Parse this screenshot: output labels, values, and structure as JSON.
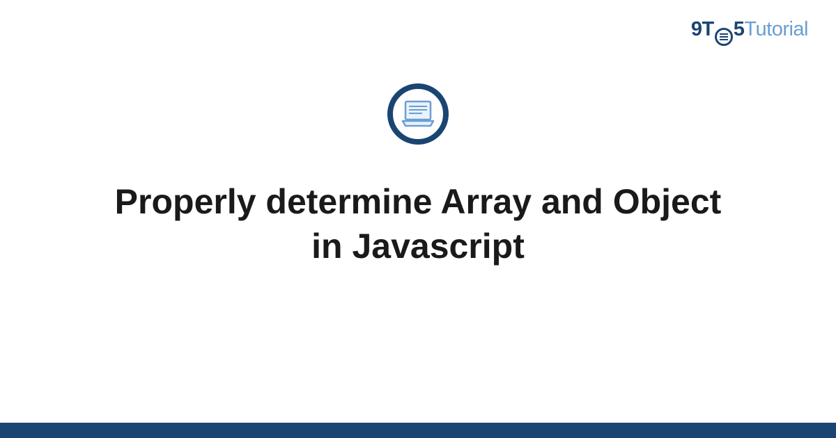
{
  "logo": {
    "nine": "9",
    "t1": "T",
    "five": "5",
    "tutorial": "Tutorial"
  },
  "title": "Properly determine Array and Object in Javascript",
  "colors": {
    "primary": "#1a4573",
    "accent": "#6a9ed4"
  }
}
